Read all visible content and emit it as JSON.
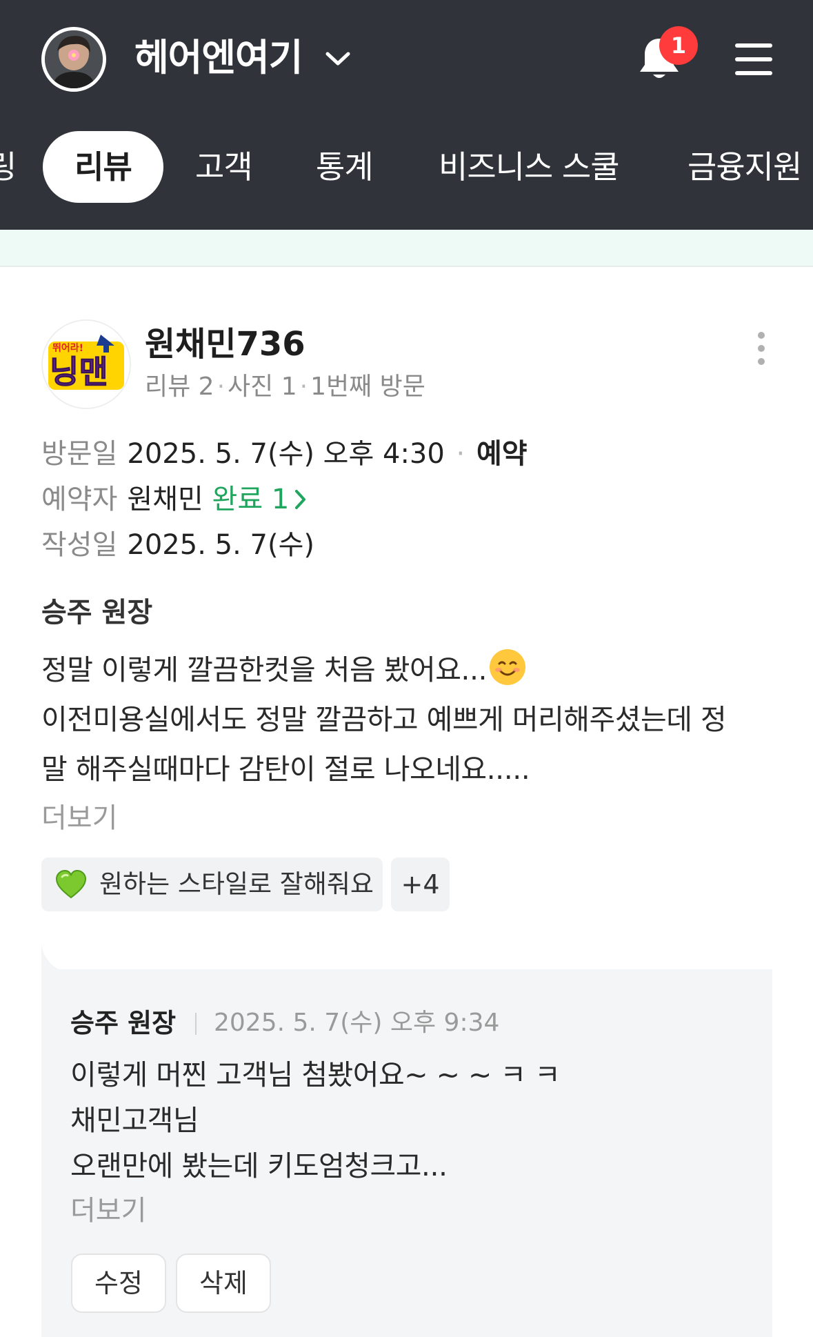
{
  "header": {
    "shop_name": "헤어엔여기",
    "notification_count": "1"
  },
  "tabs": [
    {
      "label": "링"
    },
    {
      "label": "리뷰",
      "active": true
    },
    {
      "label": "고객"
    },
    {
      "label": "통계"
    },
    {
      "label": "비즈니스 스쿨"
    },
    {
      "label": "금융지원"
    }
  ],
  "review": {
    "reviewer_name": "원채민736",
    "avatar_label": "런닝맨",
    "meta_reviews": "리뷰 2",
    "meta_photos": "사진 1",
    "meta_visits": "1번째 방문",
    "visit_label": "방문일",
    "visit_value": "2025. 5. 7(수) 오후 4:30",
    "visit_type": "예약",
    "booker_label": "예약자",
    "booker_value": "원채민",
    "booker_status": "완료 1",
    "written_label": "작성일",
    "written_value": "2025. 5. 7(수)",
    "designer": "승주 원장",
    "text_line1": "정말 이렇게 깔끔한컷을 처음 봤어요...",
    "text_line2": "이전미용실에서도 정말 깔끔하고 예쁘게 머리해주셨는데 정",
    "text_line3": "말 해주실때마다 감탄이 절로 나오네요.....",
    "more": "더보기",
    "tag_main": "원하는 스타일로 잘해줘요",
    "tag_more": "+4"
  },
  "reply": {
    "author": "승주 원장",
    "date": "2025. 5. 7(수) 오후 9:34",
    "line1": "이렇게 머찐 고객님 첨봤어요~ ~ ~ ㅋ ㅋ",
    "line2": "채민고객님",
    "line3": "오랜만에 봤는데 키도엄청크고...",
    "more": "더보기",
    "edit_label": "수정",
    "delete_label": "삭제"
  },
  "colors": {
    "header_bg": "#30343a",
    "accent_green": "#1fa55e",
    "badge_red": "#ff3b3b"
  }
}
